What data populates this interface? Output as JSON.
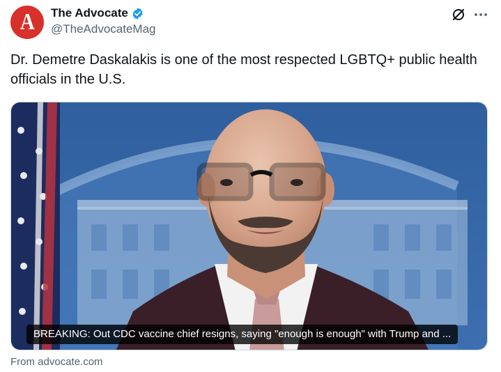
{
  "author": {
    "avatar_letter": "A",
    "display_name": "The Advocate",
    "handle": "@TheAdvocateMag",
    "verified": true
  },
  "tweet": {
    "text": "Dr. Demetre Daskalakis is one of the most respected LGBTQ+ public health officials in the U.S."
  },
  "card": {
    "headline": "BREAKING: Out CDC vaccine chief resigns, saying \"enough is enough\" with Trump and ...",
    "source": "From advocate.com"
  },
  "colors": {
    "brand_red": "#d8302a",
    "verified_blue": "#1d9bf0",
    "secondary_text": "#536471"
  },
  "icons": {
    "grok": "grok-icon",
    "more": "more-icon",
    "verified": "verified-badge-icon"
  }
}
